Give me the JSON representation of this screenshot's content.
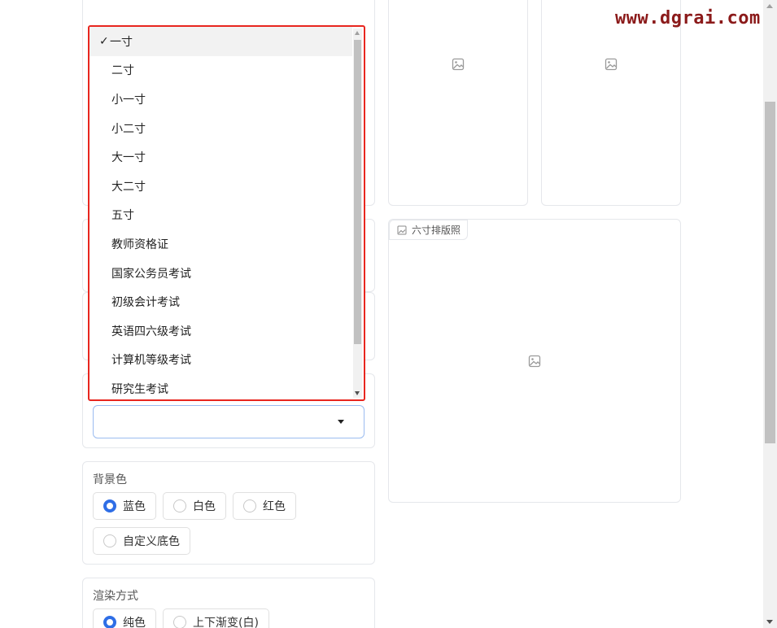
{
  "watermark": "www.dgrai.com",
  "preview": {
    "six_inch_label": "六寸排版照",
    "placeholder_icon": "image-icon"
  },
  "size_dropdown": {
    "selected_index": 0,
    "check_mark": "✓",
    "options": [
      "一寸",
      "二寸",
      "小一寸",
      "小二寸",
      "大一寸",
      "大二寸",
      "五寸",
      "教师资格证",
      "国家公务员考试",
      "初级会计考试",
      "英语四六级考试",
      "计算机等级考试",
      "研究生考试"
    ],
    "select_value": ""
  },
  "background": {
    "title": "背景色",
    "options": [
      "蓝色",
      "白色",
      "红色",
      "自定义底色"
    ],
    "selected_index": 0
  },
  "render_mode": {
    "title": "渲染方式",
    "options": [
      "纯色",
      "上下渐变(白)"
    ],
    "selected_index": 0
  },
  "colors": {
    "accent": "#2f6ee6",
    "highlight_border": "#e8261f",
    "watermark": "#8b1a1a"
  }
}
